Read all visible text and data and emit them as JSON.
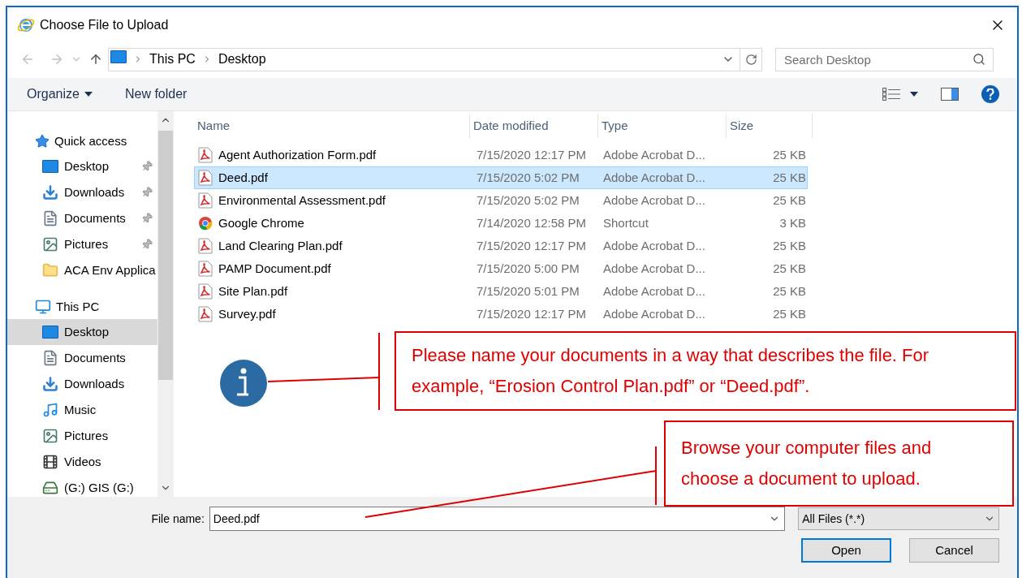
{
  "window": {
    "title": "Choose File to Upload"
  },
  "address": {
    "path": [
      {
        "label": "This PC"
      },
      {
        "label": "Desktop"
      }
    ],
    "search_placeholder": "Search Desktop"
  },
  "toolbar": {
    "organize": "Organize",
    "new_folder": "New folder"
  },
  "sidebar": {
    "groups": [
      {
        "label": "Quick access",
        "kind": "star",
        "children": [
          {
            "label": "Desktop",
            "kind": "desktop",
            "pinned": true,
            "selected": false
          },
          {
            "label": "Downloads",
            "kind": "downloads",
            "pinned": true,
            "selected": false
          },
          {
            "label": "Documents",
            "kind": "documents",
            "pinned": true,
            "selected": false
          },
          {
            "label": "Pictures",
            "kind": "pictures",
            "pinned": true,
            "selected": false
          },
          {
            "label": "ACA Env Applica",
            "kind": "folder",
            "pinned": false,
            "selected": false
          }
        ]
      },
      {
        "label": "This PC",
        "kind": "pc",
        "children": [
          {
            "label": "Desktop",
            "kind": "desktop",
            "pinned": false,
            "selected": true
          },
          {
            "label": "Documents",
            "kind": "documents",
            "pinned": false,
            "selected": false
          },
          {
            "label": "Downloads",
            "kind": "downloads",
            "pinned": false,
            "selected": false
          },
          {
            "label": "Music",
            "kind": "music",
            "pinned": false,
            "selected": false
          },
          {
            "label": "Pictures",
            "kind": "pictures",
            "pinned": false,
            "selected": false
          },
          {
            "label": "Videos",
            "kind": "videos",
            "pinned": false,
            "selected": false
          },
          {
            "label": "(G:) GIS (G:)",
            "kind": "drive",
            "pinned": false,
            "selected": false
          }
        ]
      }
    ]
  },
  "table": {
    "columns": [
      "Name",
      "Date modified",
      "Type",
      "Size"
    ],
    "rows": [
      {
        "name": "Agent Authorization Form.pdf",
        "date": "7/15/2020 12:17 PM",
        "type": "Adobe Acrobat D...",
        "size": "25 KB",
        "kind": "pdf",
        "selected": false
      },
      {
        "name": "Deed.pdf",
        "date": "7/15/2020 5:02 PM",
        "type": "Adobe Acrobat D...",
        "size": "25 KB",
        "kind": "pdf",
        "selected": true
      },
      {
        "name": "Environmental Assessment.pdf",
        "date": "7/15/2020 5:02 PM",
        "type": "Adobe Acrobat D...",
        "size": "25 KB",
        "kind": "pdf",
        "selected": false
      },
      {
        "name": "Google Chrome",
        "date": "7/14/2020 12:58 PM",
        "type": "Shortcut",
        "size": "3 KB",
        "kind": "shortcut",
        "selected": false
      },
      {
        "name": "Land Clearing Plan.pdf",
        "date": "7/15/2020 12:17 PM",
        "type": "Adobe Acrobat D...",
        "size": "25 KB",
        "kind": "pdf",
        "selected": false
      },
      {
        "name": "PAMP Document.pdf",
        "date": "7/15/2020 5:00 PM",
        "type": "Adobe Acrobat D...",
        "size": "25 KB",
        "kind": "pdf",
        "selected": false
      },
      {
        "name": "Site Plan.pdf",
        "date": "7/15/2020 5:01 PM",
        "type": "Adobe Acrobat D...",
        "size": "25 KB",
        "kind": "pdf",
        "selected": false
      },
      {
        "name": "Survey.pdf",
        "date": "7/15/2020 12:17 PM",
        "type": "Adobe Acrobat D...",
        "size": "25 KB",
        "kind": "pdf",
        "selected": false
      }
    ]
  },
  "footer": {
    "file_name_label": "File name:",
    "file_name_value": "Deed.pdf",
    "file_type": "All Files (*.*)",
    "open": "Open",
    "cancel": "Cancel"
  },
  "annotations": [
    {
      "text": "Please name your documents in a way that describes the file. For example, “Erosion Control Plan.pdf” or “Deed.pdf”."
    },
    {
      "text": "Browse your computer files and choose a document to upload."
    }
  ]
}
